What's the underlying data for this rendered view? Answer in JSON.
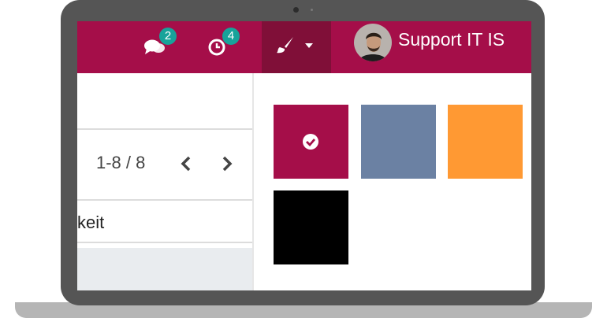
{
  "colors": {
    "brand": "#a50e49",
    "swatches": [
      "#a50e49",
      "#6b81a3",
      "#ff9933",
      "#000000"
    ]
  },
  "navbar": {
    "messages": {
      "icon": "chat-icon",
      "count": "2"
    },
    "activities": {
      "icon": "clock-icon",
      "count": "4"
    },
    "theme": {
      "icon": "paintbrush-icon"
    },
    "user": {
      "name": "Support IT IS"
    }
  },
  "list": {
    "pager": "1-8 / 8",
    "row_text": "keit"
  },
  "color_picker": {
    "selected_index": 0,
    "selected_icon": "check-circle-icon"
  }
}
